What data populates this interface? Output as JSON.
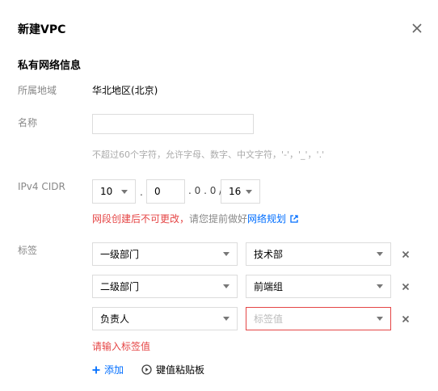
{
  "dialog": {
    "title": "新建VPC",
    "section_title": "私有网络信息"
  },
  "region": {
    "label": "所属地域",
    "value": "华北地区(北京)"
  },
  "name": {
    "label": "名称",
    "value": "",
    "placeholder": "",
    "hint": "不超过60个字符，允许字母、数字、中文字符，'-'，'_'，'.'"
  },
  "cidr": {
    "label": "IPv4 CIDR",
    "octet1": "10",
    "octet2": "0",
    "fixed": ". 0 . 0 /",
    "dot1": ".",
    "mask": "16",
    "warning": "网段创建后不可更改，",
    "hint_prefix": "请您提前做好",
    "link": "网络规划"
  },
  "tags": {
    "label": "标签",
    "rows": [
      {
        "key": "一级部门",
        "value": "技术部",
        "value_placeholder": false
      },
      {
        "key": "二级部门",
        "value": "前端组",
        "value_placeholder": false
      },
      {
        "key": "负责人",
        "value": "标签值",
        "value_placeholder": true
      }
    ],
    "error": "请输入标签值",
    "add_label": "添加",
    "paste_label": "键值粘贴板"
  },
  "colors": {
    "accent": "#006eff",
    "error": "#e54545"
  }
}
